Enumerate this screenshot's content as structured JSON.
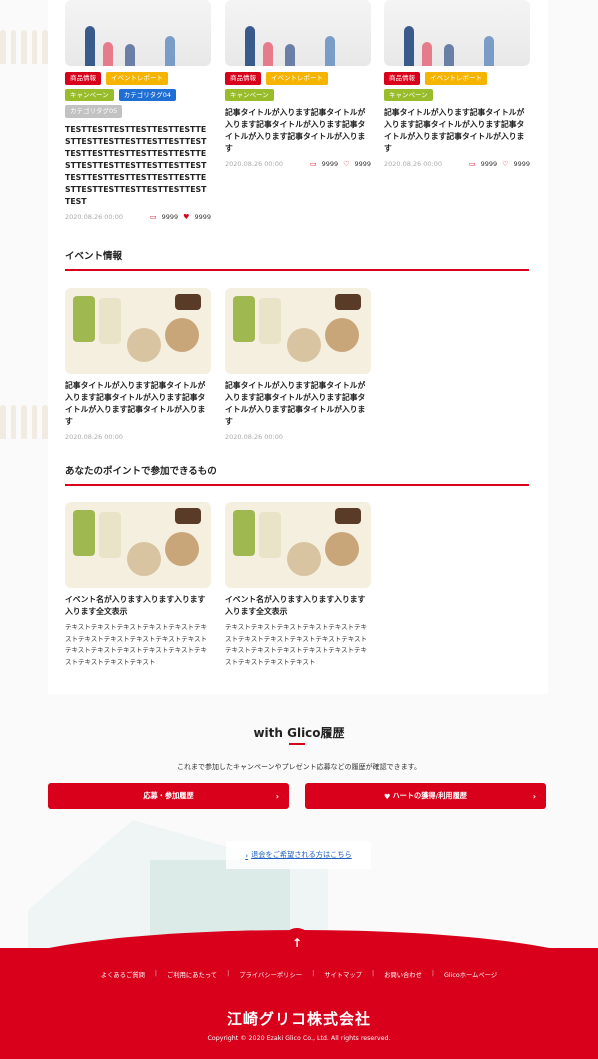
{
  "articles": [
    {
      "tags": [
        {
          "label": "商品情報",
          "color": "red"
        },
        {
          "label": "イベントレポート",
          "color": "yellow"
        },
        {
          "label": "キャンペーン",
          "color": "green"
        },
        {
          "label": "カテゴリタグ04",
          "color": "blue"
        },
        {
          "label": "カテゴリタグ05",
          "color": "gray"
        }
      ],
      "title": "TESTTESTTESTTESTTESTTESTTESTTESTTESTTESTTESTTESTTESTTESTTESTTESTTESTTESTTESTTESTTESTTESTTESTTESTTESTTESTTESTTESTTESTTESTTESTTESTTESTTESTTESTTESTTESTTESTTESTTEST",
      "date": "2020.08.26 00:00",
      "comments": "9999",
      "hearts": "9999"
    },
    {
      "tags": [
        {
          "label": "商品情報",
          "color": "red"
        },
        {
          "label": "イベントレポート",
          "color": "yellow"
        },
        {
          "label": "キャンペーン",
          "color": "green"
        }
      ],
      "title": "記事タイトルが入ります記事タイトルが入ります記事タイトルが入ります記事タイトルが入ります記事タイトルが入ります",
      "date": "2020.08.26 00:00",
      "comments": "9999",
      "hearts": "9999"
    },
    {
      "tags": [
        {
          "label": "商品情報",
          "color": "red"
        },
        {
          "label": "イベントレポート",
          "color": "yellow"
        },
        {
          "label": "キャンペーン",
          "color": "green"
        }
      ],
      "title": "記事タイトルが入ります記事タイトルが入ります記事タイトルが入ります記事タイトルが入ります記事タイトルが入ります",
      "date": "2020.08.26 00:00",
      "comments": "9999",
      "hearts": "9999"
    }
  ],
  "events": {
    "heading": "イベント情報",
    "items": [
      {
        "title": "記事タイトルが入ります記事タイトルが入ります記事タイトルが入ります記事タイトルが入ります記事タイトルが入ります",
        "date": "2020.08.26 00:00"
      },
      {
        "title": "記事タイトルが入ります記事タイトルが入ります記事タイトルが入ります記事タイトルが入ります記事タイトルが入ります",
        "date": "2020.08.26 00:00"
      }
    ]
  },
  "points": {
    "heading": "あなたのポイントで参加できるもの",
    "items": [
      {
        "title": "イベント名が入ります入ります入ります入ります全文表示",
        "desc": "テキストテキストテキストテキストテキストテキストテキストテキストテキストテキストテキストテキストテキストテキストテキストテキストテキストテキストテキストテキスト"
      },
      {
        "title": "イベント名が入ります入ります入ります入ります全文表示",
        "desc": "テキストテキストテキストテキストテキストテキストテキストテキストテキストテキストテキストテキストテキストテキストテキストテキストテキストテキストテキストテキスト"
      }
    ]
  },
  "history": {
    "title": "with Glico履歴",
    "desc": "これまで参加したキャンペーンやプレゼント応募などの履歴が確認できます。",
    "btn_apply": "応募・参加履歴",
    "btn_heart": "ハートの獲得/利用履歴",
    "optout": "退会をご希望される方はこちら"
  },
  "footer": {
    "links": [
      "よくあるご質問",
      "ご利用にあたって",
      "プライバシーポリシー",
      "サイトマップ",
      "お問い合わせ",
      "Glicoホームページ"
    ],
    "logo": "江崎グリコ株式会社",
    "copyright": "Copyright © 2020 Ezaki Glico Co., Ltd. All rights reserved."
  },
  "colors": {
    "accent": "#d9001b",
    "tag_yellow": "#f5b400",
    "tag_green": "#99bd2a",
    "tag_blue": "#1f6ed4",
    "tag_gray": "#c2c2c2"
  }
}
